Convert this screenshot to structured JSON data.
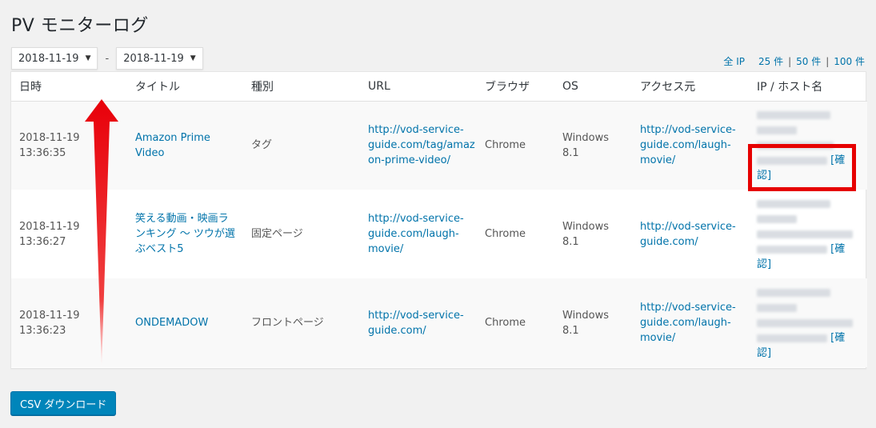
{
  "page": {
    "title": "PV モニターログ"
  },
  "filters": {
    "date_from": "2018-11-19",
    "date_to": "2018-11-19",
    "separator": "-"
  },
  "per_page": {
    "all_ip": "全 IP",
    "options": [
      "25 件",
      "50 件",
      "100 件"
    ]
  },
  "table": {
    "headers": [
      "日時",
      "タイトル",
      "種別",
      "URL",
      "ブラウザ",
      "OS",
      "アクセス元",
      "IP / ホスト名"
    ],
    "rows": [
      {
        "date": "2018-11-19",
        "time": "13:36:35",
        "title": "Amazon Prime Video",
        "type": "タグ",
        "url": "http://vod-service-guide.com/tag/amazon-prime-video/",
        "browser": "Chrome",
        "os": "Windows 8.1",
        "referrer": "http://vod-service-guide.com/laugh-movie/",
        "confirm_a": "[確",
        "confirm_b": "認]"
      },
      {
        "date": "2018-11-19",
        "time": "13:36:27",
        "title": "笑える動画・映画ランキング ～ ツウが選ぶベスト5",
        "type": "固定ページ",
        "url": "http://vod-service-guide.com/laugh-movie/",
        "browser": "Chrome",
        "os": "Windows 8.1",
        "referrer": "http://vod-service-guide.com/",
        "confirm_a": "[確",
        "confirm_b": "認]"
      },
      {
        "date": "2018-11-19",
        "time": "13:36:23",
        "title": "ONDEMADOW",
        "type": "フロントページ",
        "url": "http://vod-service-guide.com/",
        "browser": "Chrome",
        "os": "Windows 8.1",
        "referrer": "http://vod-service-guide.com/laugh-movie/",
        "confirm_a": "[確",
        "confirm_b": "認]"
      }
    ]
  },
  "csv_button": "CSV ダウンロード",
  "colors": {
    "link": "#0073aa",
    "button": "#0085ba",
    "highlight": "#e60000"
  }
}
